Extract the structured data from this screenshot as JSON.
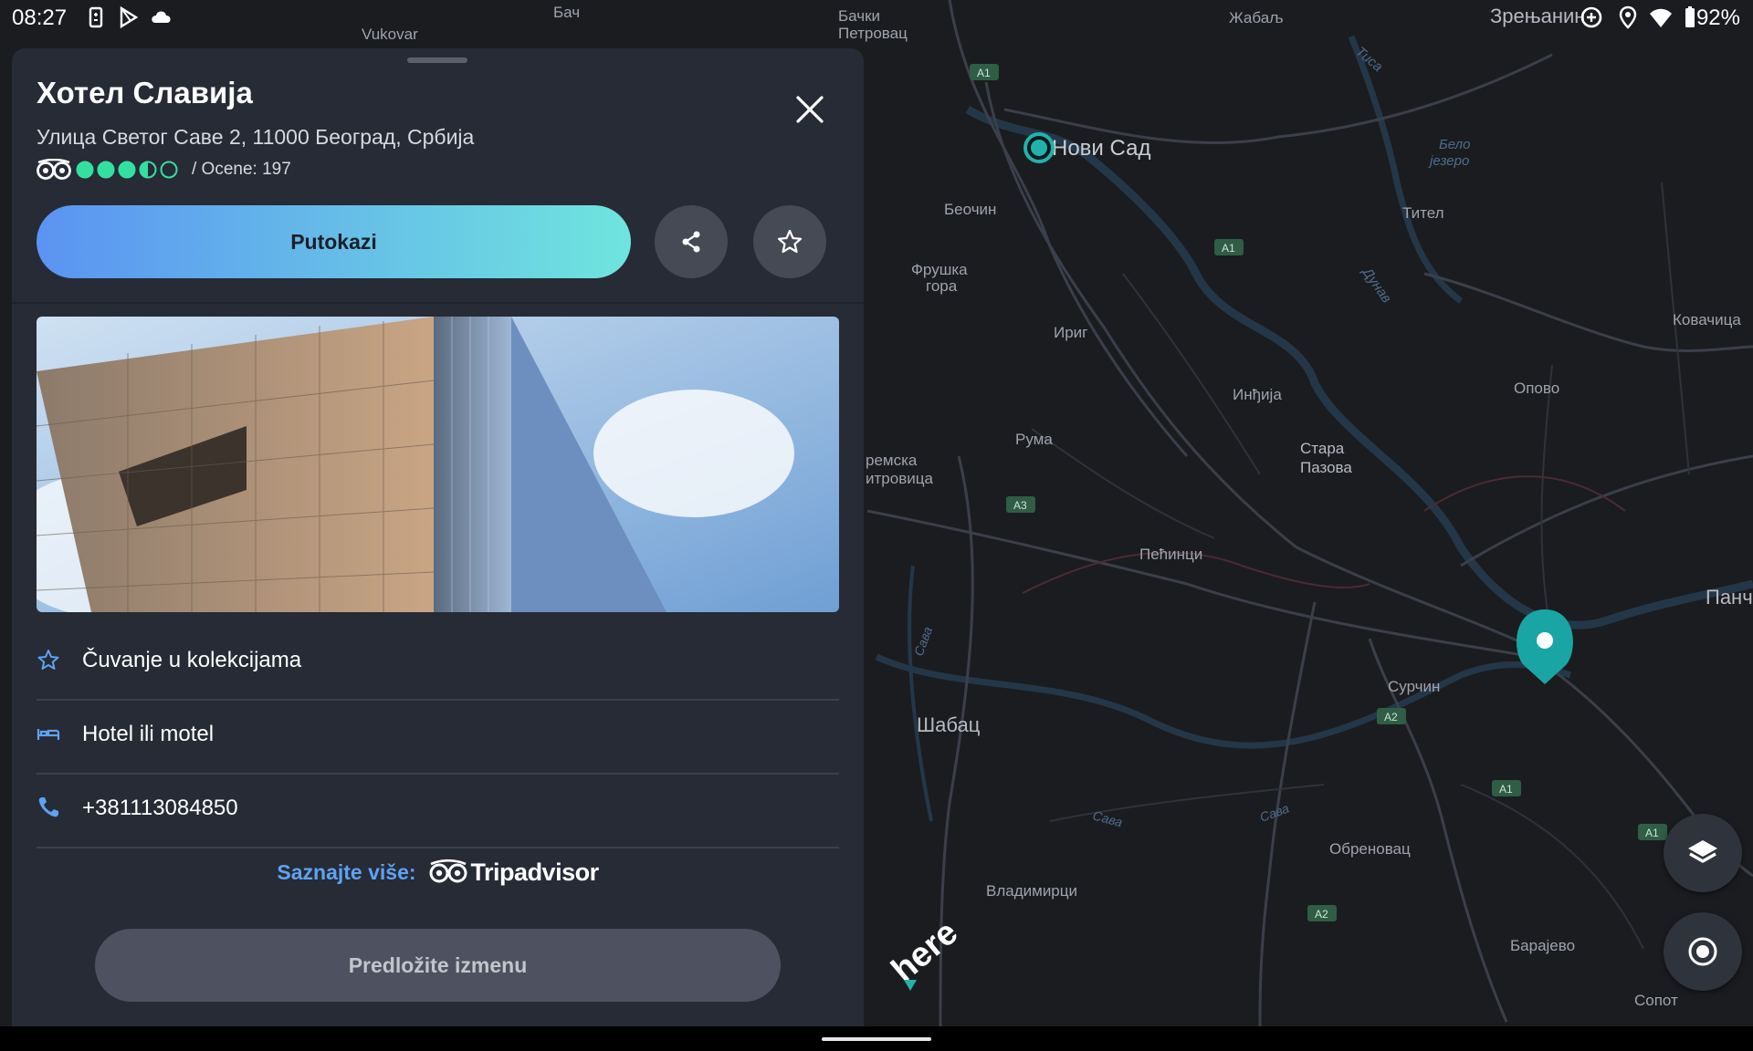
{
  "status_bar": {
    "time": "08:27",
    "battery": "92%",
    "icons": [
      "battery-saver-icon",
      "play-store-icon",
      "cloud-icon",
      "data-saver-icon",
      "location-icon",
      "wifi-icon",
      "battery-icon"
    ]
  },
  "place": {
    "name": "Хотел Славија",
    "address": "Улица Светог Саве 2, 11000 Београд, Србија",
    "rating": {
      "bubbles": 3.5,
      "max": 5,
      "reviews_text": "/ Ocene: 197"
    }
  },
  "actions": {
    "directions_label": "Putokazi",
    "share_icon": "share-icon",
    "favorite_icon": "star-icon"
  },
  "details": [
    {
      "icon": "star-outline-icon",
      "text": "Čuvanje u kolekcijama"
    },
    {
      "icon": "bed-icon",
      "text": "Hotel ili motel"
    },
    {
      "icon": "phone-icon",
      "text": "+381113084850"
    }
  ],
  "learn_more": {
    "label": "Saznajte više:",
    "brand": "Tripadvisor"
  },
  "suggest_edit_label": "Predložite izmenu",
  "map": {
    "labels": [
      "Vukovar",
      "Бач",
      "Бачки",
      "Петровац",
      "Жабаљ",
      "Зрењанин",
      "Нови Сад",
      "Тиса",
      "Бело",
      "језеро",
      "Беочин",
      "Тител",
      "Фрушка",
      "гора",
      "Дунав",
      "Ковачица",
      "Ириг",
      "Инђија",
      "Опово",
      "Рума",
      "Стара",
      "Пазова",
      "ремска",
      "итровица",
      "Пећинци",
      "Панче",
      "Сава",
      "Сурчин",
      "Шабац",
      "Обреновац",
      "Владимирци",
      "Барајево",
      "Сопот"
    ],
    "road_shields": [
      "A1",
      "A1",
      "A3",
      "A2",
      "A1",
      "A1",
      "A2"
    ],
    "logo": "here"
  },
  "colors": {
    "panel_bg": "#262b36",
    "accent_blue": "#5b93f2",
    "accent_teal": "#6fe5de",
    "pin": "#1aa5a5",
    "rating_green": "#34e0a1"
  }
}
